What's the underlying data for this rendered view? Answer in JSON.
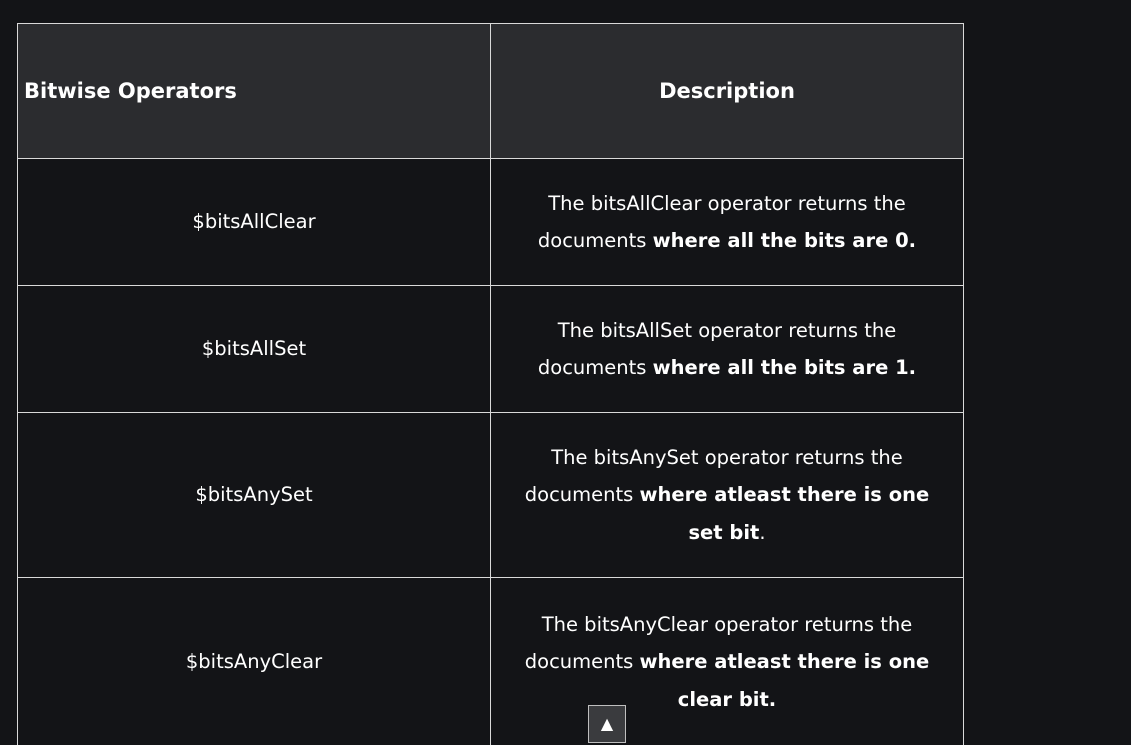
{
  "table": {
    "headers": {
      "operator": "Bitwise Operators",
      "description": "Description"
    },
    "rows": [
      {
        "operator": "$bitsAllClear",
        "desc_plain": "The bitsAllClear operator returns the documents ",
        "desc_bold": "where all the bits are 0.",
        "desc_tail": ""
      },
      {
        "operator": "$bitsAllSet",
        "desc_plain": "The bitsAllSet operator returns the documents ",
        "desc_bold": "where all the bits are 1.",
        "desc_tail": ""
      },
      {
        "operator": "$bitsAnySet",
        "desc_plain": "The bitsAnySet operator returns the documents ",
        "desc_bold": "where atleast there is one set bit",
        "desc_tail": "."
      },
      {
        "operator": "$bitsAnyClear",
        "desc_plain": "The bitsAnyClear operator returns the documents ",
        "desc_bold": "where atleast there is one clear bit.",
        "desc_tail": ""
      }
    ]
  },
  "scroll_top": {
    "glyph": "▲",
    "icon": "arrow-up-icon"
  },
  "colors": {
    "page_background": "#131417",
    "header_background": "#2b2c2f",
    "border": "#d9d9d9",
    "text": "#ffffff"
  }
}
